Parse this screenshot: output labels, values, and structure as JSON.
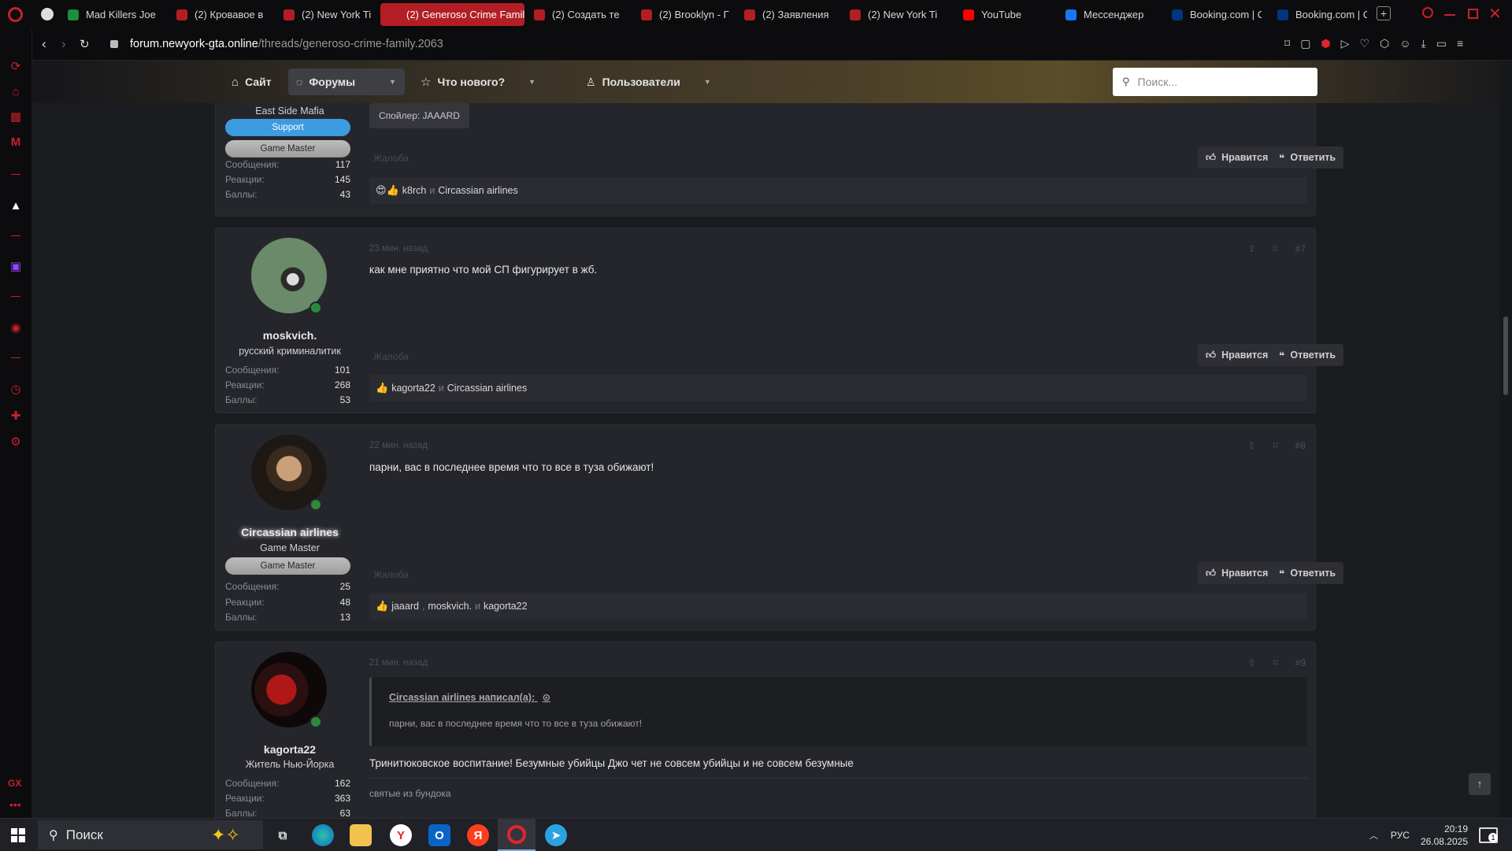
{
  "browser": {
    "tabs": [
      {
        "title": "Mad Killers Joe",
        "icon": "sheets-icon",
        "color": "#1e8e3e"
      },
      {
        "title": "(2) Кровавое в",
        "icon": "forum-icon",
        "color": "#b21e24"
      },
      {
        "title": "(2) New York Ti",
        "icon": "forum-icon",
        "color": "#b21e24"
      },
      {
        "title": "(2) Generoso Crime Famil",
        "icon": "forum-icon",
        "color": "#b21e24",
        "active": true
      },
      {
        "title": "(2) Создать те",
        "icon": "forum-icon",
        "color": "#b21e24"
      },
      {
        "title": "(2) Brooklyn - Г",
        "icon": "forum-icon",
        "color": "#b21e24"
      },
      {
        "title": "(2) Заявления",
        "icon": "forum-icon",
        "color": "#b21e24"
      },
      {
        "title": "(2) New York Ti",
        "icon": "forum-icon",
        "color": "#b21e24"
      },
      {
        "title": "YouTube",
        "icon": "youtube-icon",
        "color": "#ff0000"
      },
      {
        "title": "Мессенджер",
        "icon": "messenger-icon",
        "color": "#1877f2"
      },
      {
        "title": "Booking.com | С",
        "icon": "booking-icon",
        "color": "#003580"
      },
      {
        "title": "Booking.com | С",
        "icon": "booking-icon",
        "color": "#003580"
      }
    ],
    "url_domain": "forum.newyork-gta.online",
    "url_path": "/threads/generoso-crime-family.2063",
    "accent": "#c8202a"
  },
  "nav": {
    "site": "Сайт",
    "forums": "Форумы",
    "whats_new": "Что нового?",
    "members": "Пользователи",
    "search_placeholder": "Поиск..."
  },
  "post6": {
    "user_title": "East Side Mafia",
    "banner1": "Support",
    "banner2": "Game Master",
    "stats": {
      "messages_label": "Сообщения:",
      "messages": "117",
      "reactions_label": "Реакции:",
      "reactions": "145",
      "points_label": "Баллы:",
      "points": "43"
    },
    "spoiler": "Спойлер: JAAARD",
    "report": "Жалоба",
    "like": "Нравится",
    "reply": "Ответить",
    "likers": [
      "k8rch",
      "Circassian airlines"
    ],
    "and": "и"
  },
  "post7": {
    "time": "23 мин. назад",
    "num": "#7",
    "username": "moskvich.",
    "user_title": "русский криминалитик",
    "stats": {
      "messages": "101",
      "reactions": "268",
      "points": "53"
    },
    "message": "как мне приятно что мой СП фигурирует в жб.",
    "likers": [
      "kagorta22",
      "Circassian airlines"
    ]
  },
  "post8": {
    "time": "22 мин. назад",
    "num": "#8",
    "username": "Circassian airlines",
    "user_title": "Game Master",
    "banner": "Game Master",
    "stats": {
      "messages": "25",
      "reactions": "48",
      "points": "13"
    },
    "message": "парни, вас в последнее время что то все в туза обижают!",
    "likers": [
      "jaaard",
      "moskvich.",
      "kagorta22"
    ],
    "comma": ","
  },
  "post9": {
    "time": "21 мин. назад",
    "num": "#9",
    "username": "kagorta22",
    "user_title": "Житель Нью-Йорка",
    "stats": {
      "messages": "162",
      "reactions": "363",
      "points": "63"
    },
    "quote_author": "Circassian airlines написал(а):",
    "quote_text": "парни, вас в последнее время что то все в туза обижают!",
    "message": "Тринитюковское воспитание! Безумные убийцы Джо чет не совсем убийцы и не совсем безумные",
    "signature": "святые из бундока"
  },
  "taskbar": {
    "search": "Поиск",
    "lang": "РУС",
    "time": "20:19",
    "date": "26.08.2025",
    "notif": "1"
  }
}
